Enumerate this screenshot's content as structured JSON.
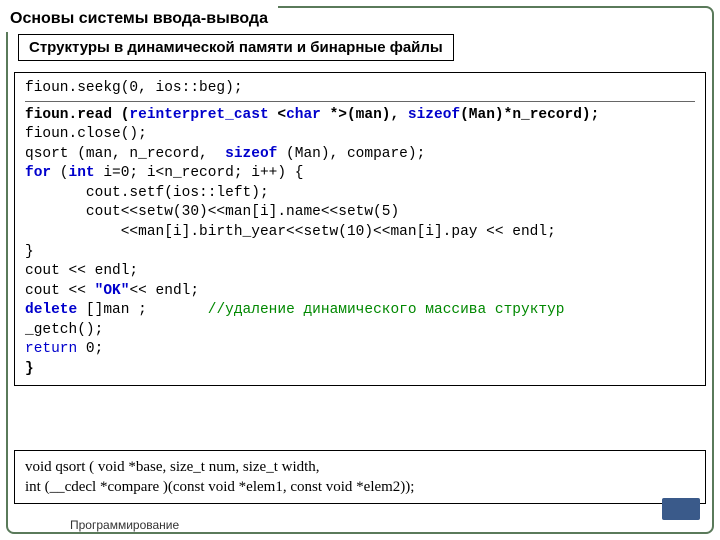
{
  "title": "Основы системы ввода-вывода",
  "subtitle": "Структуры в динамической памяти и бинарные файлы",
  "code": {
    "l1a": "fioun.seekg(0, ios::beg);",
    "l2a": "fioun.read (",
    "l2b": "reinterpret_cast",
    "l2c": " <",
    "l2d": "char",
    "l2e": " *>(man), ",
    "l2f": "sizeof",
    "l2g": "(Man)*n_record);",
    "l3": "fioun.close();",
    "l4a": "qsort (man, n_record,  ",
    "l4b": "sizeof",
    "l4c": " (Man), compare);",
    "l5a": "for",
    "l5b": " (",
    "l5c": "int",
    "l5d": " i=0; i<n_record; i++) {",
    "l6": "       cout.setf(ios::left);",
    "l7": "       cout<<setw(30)<<man[i].name<<setw(5)",
    "l8": "           <<man[i].birth_year<<setw(10)<<man[i].pay << endl;",
    "l9": "}",
    "l10": "cout << endl;",
    "l11a": "cout << ",
    "l11b": "\"OK\"",
    "l11c": "<< endl;",
    "l12a": "delete",
    "l12b": " []man ;       ",
    "l12c": "//удаление динамического массива структур",
    "l13": "_getch();",
    "l14a": "return",
    "l14b": " 0;",
    "l15": "}"
  },
  "footer": {
    "line1": "void qsort ( void *base,   size_t num,  size_t width,",
    "line2": "                      int (__cdecl *compare )(const void *elem1, const void *elem2));"
  },
  "caption": "Программирование"
}
